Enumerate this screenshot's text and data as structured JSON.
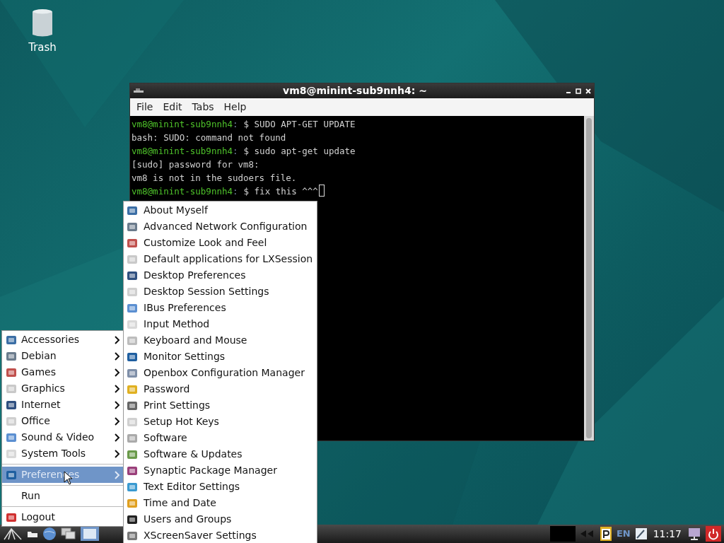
{
  "desktop_icons": [
    {
      "label": "Trash"
    }
  ],
  "terminal": {
    "title": "vm8@minint-sub9nnh4: ~",
    "menu": [
      "File",
      "Edit",
      "Tabs",
      "Help"
    ],
    "lines": [
      {
        "kind": "prompt",
        "user": "vm8@minint-sub9nnh4",
        "separator": ":",
        "command": "$ SUDO APT-GET UPDATE",
        "cursor": false
      },
      {
        "kind": "output",
        "text": "bash: SUDO: command not found"
      },
      {
        "kind": "prompt",
        "user": "vm8@minint-sub9nnh4",
        "separator": ":",
        "command": "$ sudo apt-get update",
        "cursor": false
      },
      {
        "kind": "output",
        "text": "[sudo] password for vm8:"
      },
      {
        "kind": "output",
        "text": "vm8 is not in the sudoers file."
      },
      {
        "kind": "prompt",
        "user": "vm8@minint-sub9nnh4",
        "separator": ":",
        "command": "$ fix this ^^^",
        "cursor": true
      }
    ]
  },
  "main_menu": [
    {
      "kind": "item",
      "label": "Accessories",
      "submenu": true,
      "selected": false
    },
    {
      "kind": "item",
      "label": "Debian",
      "submenu": true,
      "selected": false
    },
    {
      "kind": "item",
      "label": "Games",
      "submenu": true,
      "selected": false
    },
    {
      "kind": "item",
      "label": "Graphics",
      "submenu": true,
      "selected": false
    },
    {
      "kind": "item",
      "label": "Internet",
      "submenu": true,
      "selected": false
    },
    {
      "kind": "item",
      "label": "Office",
      "submenu": true,
      "selected": false
    },
    {
      "kind": "item",
      "label": "Sound & Video",
      "submenu": true,
      "selected": false
    },
    {
      "kind": "item",
      "label": "System Tools",
      "submenu": true,
      "selected": false
    },
    {
      "kind": "separator"
    },
    {
      "kind": "item",
      "label": "Preferences",
      "submenu": true,
      "selected": true
    },
    {
      "kind": "separator"
    },
    {
      "kind": "item",
      "label": "Run",
      "submenu": false,
      "selected": false,
      "noicon": true
    },
    {
      "kind": "separator"
    },
    {
      "kind": "item",
      "label": "Logout",
      "submenu": false,
      "selected": false
    }
  ],
  "preferences_menu": [
    "About Myself",
    "Advanced Network Configuration",
    "Customize Look and Feel",
    "Default applications for LXSession",
    "Desktop Preferences",
    "Desktop Session Settings",
    "IBus Preferences",
    "Input Method",
    "Keyboard and Mouse",
    "Monitor Settings",
    "Openbox Configuration Manager",
    "Password",
    "Print Settings",
    "Setup Hot Keys",
    "Software",
    "Software & Updates",
    "Synaptic Package Manager",
    "Text Editor Settings",
    "Time and Date",
    "Users and Groups",
    "XScreenSaver Settings"
  ],
  "taskbar": {
    "keyboard_layout": "EN",
    "clock": "11:17"
  }
}
